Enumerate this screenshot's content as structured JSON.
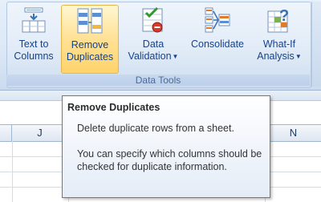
{
  "ribbon": {
    "group_label": "Data Tools",
    "buttons": [
      {
        "line1": "Text to",
        "line2": "Columns",
        "icon": "text-to-columns-icon",
        "dropdown": false
      },
      {
        "line1": "Remove",
        "line2": "Duplicates",
        "icon": "remove-duplicates-icon",
        "dropdown": false,
        "active": true
      },
      {
        "line1": "Data",
        "line2": "Validation",
        "icon": "data-validation-icon",
        "dropdown": true
      },
      {
        "line1": "Consolidate",
        "line2": "",
        "icon": "consolidate-icon",
        "dropdown": false
      },
      {
        "line1": "What-If",
        "line2": "Analysis",
        "icon": "what-if-analysis-icon",
        "dropdown": true
      }
    ]
  },
  "sheet": {
    "column_headers": [
      "J",
      "N"
    ]
  },
  "tooltip": {
    "title": "Remove Duplicates",
    "line1": "Delete duplicate rows from a sheet.",
    "line2": "You can specify which columns should be checked for duplicate information."
  },
  "colors": {
    "ribbon_text": "#15428b",
    "active_button": "#ffe39a",
    "group_label_text": "#4a6a99"
  }
}
